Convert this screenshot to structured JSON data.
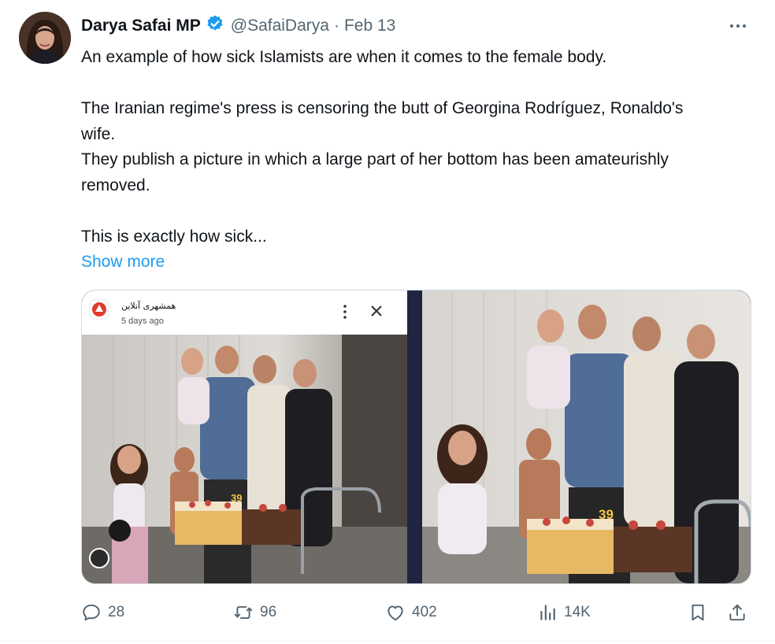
{
  "author": {
    "name": "Darya Safai MP",
    "handle": "@SafaiDarya",
    "separator": "·",
    "date": "Feb 13",
    "verified": true
  },
  "tweet": {
    "lines": [
      "An example of how sick Islamists are when it comes to the female body.",
      "The Iranian regime's press is censoring the butt of Georgina Rodríguez, Ronaldo's wife.",
      "They publish a picture in which a large part of her bottom has been amateurishly removed.",
      "This is exactly how sick..."
    ],
    "show_more": "Show more"
  },
  "media": {
    "left_card": {
      "source_name": "همشهری آنلاین",
      "time_ago": "5 days ago",
      "birthday_number": "39"
    },
    "right_photo": {
      "birthday_number": "39"
    }
  },
  "actions": {
    "replies": "28",
    "retweets": "96",
    "likes": "402",
    "views": "14K"
  },
  "colors": {
    "accent": "#1d9bf0",
    "text_primary": "#0f1419",
    "text_secondary": "#536471",
    "border": "#cfd9de"
  }
}
